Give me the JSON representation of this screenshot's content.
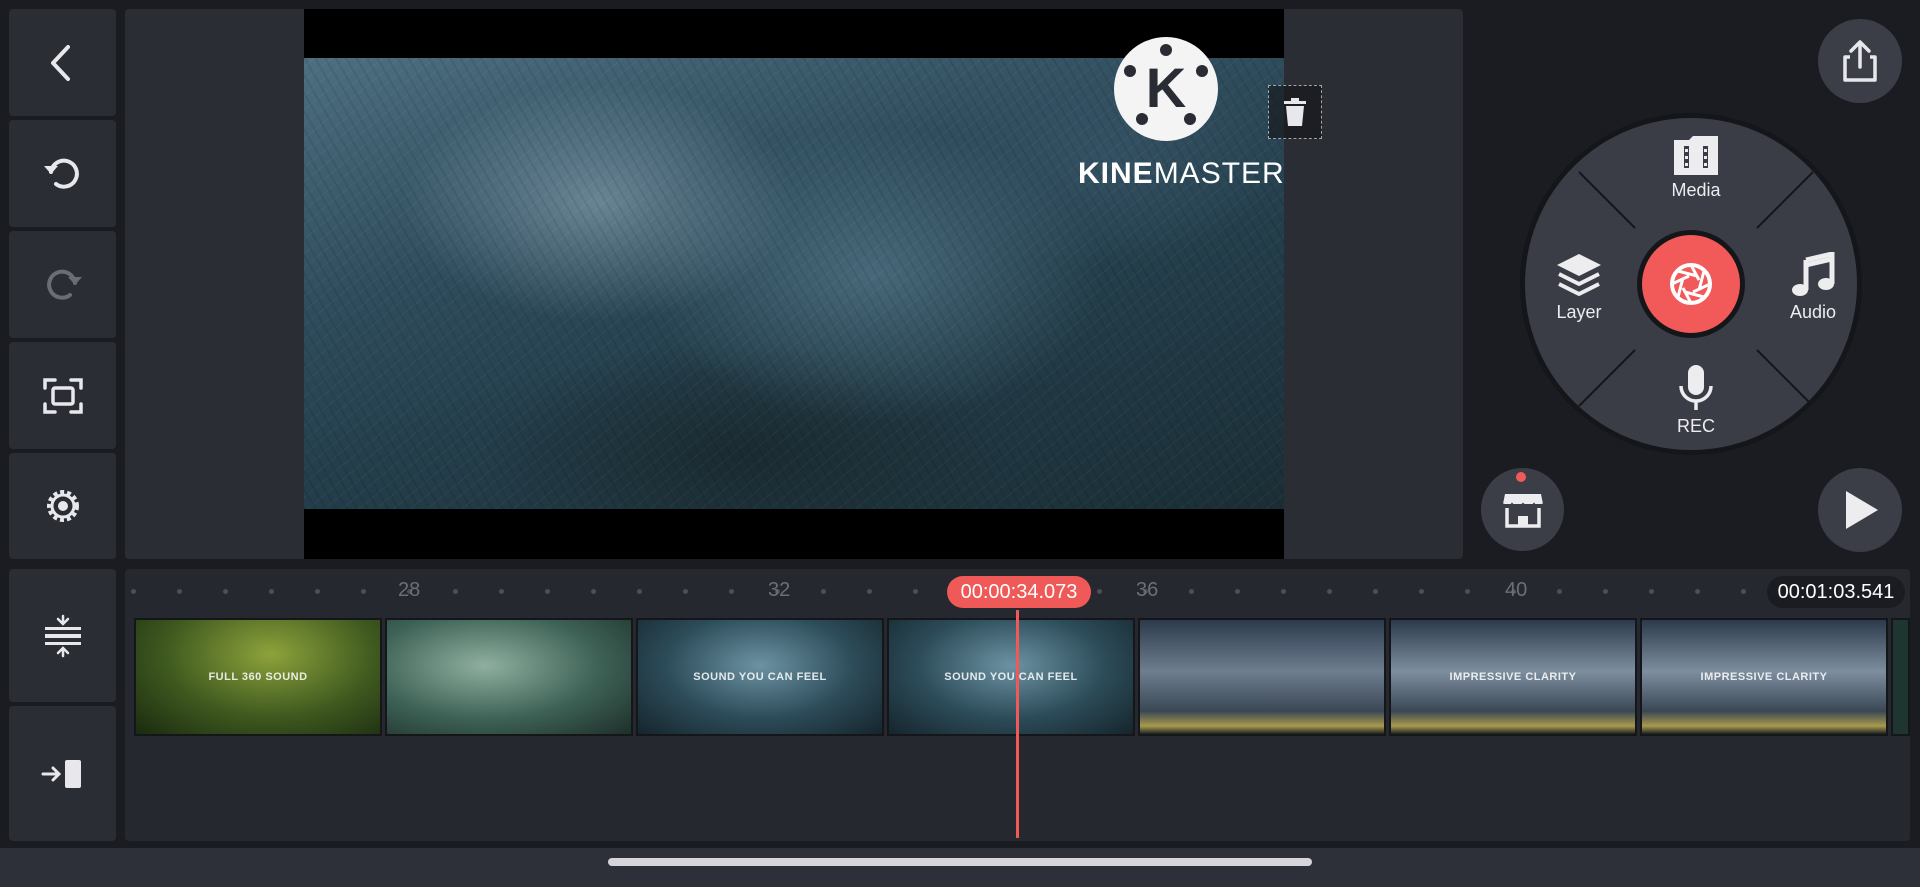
{
  "app": {
    "name": "KineMaster",
    "watermark_prefix": "KINE",
    "watermark_suffix": "MASTER",
    "watermark_letter": "K"
  },
  "left_toolbar": [
    {
      "name": "back-icon"
    },
    {
      "name": "undo-icon"
    },
    {
      "name": "redo-icon"
    },
    {
      "name": "fullscreen-icon"
    },
    {
      "name": "settings-icon"
    }
  ],
  "timeline_tools": [
    {
      "name": "timeline-expand-icon"
    },
    {
      "name": "jump-to-end-icon"
    }
  ],
  "media_wheel": {
    "media_label": "Media",
    "audio_label": "Audio",
    "layer_label": "Layer",
    "rec_label": "REC",
    "record_icon": "camera-shutter-icon"
  },
  "colors": {
    "accent": "#ef5957",
    "panel": "#2b2d35",
    "background": "#1b1c22"
  },
  "timeline": {
    "playhead_time": "00:00:34.073",
    "total_time": "00:01:03.541",
    "ruler_labels": [
      "28",
      "32",
      "36",
      "40"
    ],
    "clips": [
      {
        "caption": "FULL 360 SOUND",
        "tone": "forest-green"
      },
      {
        "caption": "",
        "tone": "forest-teal"
      },
      {
        "caption": "SOUND YOU CAN FEEL",
        "tone": "forest-blue"
      },
      {
        "caption": "SOUND YOU CAN FEEL",
        "tone": "forest-blue"
      },
      {
        "caption": "",
        "tone": "storm-cloud"
      },
      {
        "caption": "IMPRESSIVE CLARITY",
        "tone": "storm-cloud"
      },
      {
        "caption": "IMPRESSIVE CLARITY",
        "tone": "storm-cloud"
      }
    ]
  }
}
